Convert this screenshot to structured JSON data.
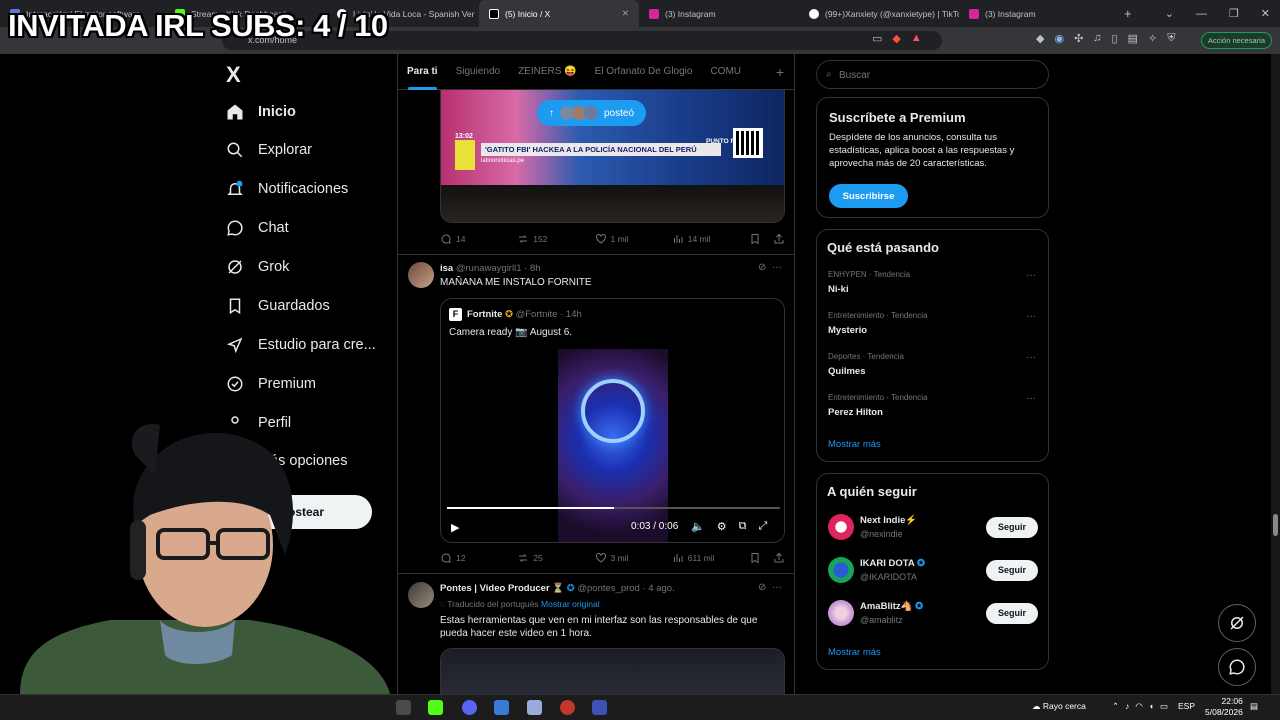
{
  "overlay": {
    "title": "INVITADA IRL SUBS: 4 / 10"
  },
  "browser": {
    "tabs": [
      {
        "label": "Interacción | El mejor software",
        "color": "#5a7bd6"
      },
      {
        "label": "Stream - Kick Dashboard",
        "color": "#53fc18"
      },
      {
        "label": "Livin' la Vida Loca - Spanish Ver",
        "color": "#ffffff"
      },
      {
        "label": "(5) Inicio / X",
        "color": "#ffffff"
      },
      {
        "label": "(3) Instagram",
        "color": "#d6249f"
      },
      {
        "label": "(99+)Xanxiety (@xanxietype) | TikTo",
        "color": "#ffffff"
      },
      {
        "label": "(3) Instagram",
        "color": "#d6249f"
      }
    ],
    "url": "x.com/home",
    "action_button": "Acción necesaria"
  },
  "nav": {
    "logo": "X",
    "items": [
      {
        "label": "Inicio",
        "icon": "home-icon"
      },
      {
        "label": "Explorar",
        "icon": "search-icon"
      },
      {
        "label": "Notificaciones",
        "icon": "bell-icon"
      },
      {
        "label": "Chat",
        "icon": "chat-icon"
      },
      {
        "label": "Grok",
        "icon": "grok-icon"
      },
      {
        "label": "Guardados",
        "icon": "bookmark-icon"
      },
      {
        "label": "Estudio para cre...",
        "icon": "rocket-icon"
      },
      {
        "label": "Premium",
        "icon": "verified-icon"
      },
      {
        "label": "Perfil",
        "icon": "person-icon"
      },
      {
        "label": "Más opciones",
        "icon": "more-icon"
      }
    ],
    "post_button": "Postear"
  },
  "feed": {
    "tabs": [
      "Para ti",
      "Siguiendo",
      "ZEINERS 😝",
      "El Orfanato De Glogio",
      "COMU"
    ],
    "tweet1": {
      "posted_pill": "posteó",
      "headline": "'GATITO FBI' HACKEA A LA POLICÍA NACIONAL DEL PERÚ",
      "source": "latinonoticias.pe",
      "badge_top": "PUNTO FINAL",
      "time": "13:02",
      "replies": "14",
      "reposts": "152",
      "likes": "1 mil",
      "views": "14 mil"
    },
    "tweet2": {
      "name": "isa",
      "handle": "@runawaygirll1",
      "time": "8h",
      "text": "MAÑANA ME INSTALO FORNITE",
      "quote": {
        "name": "Fortnite",
        "handle": "@Fortnite",
        "time": "14h",
        "text": "Camera ready 📷 August 6.",
        "video_time": "0:03 / 0:06",
        "progress": 0.5
      },
      "replies": "12",
      "reposts": "25",
      "likes": "3 mil",
      "views": "611 mil"
    },
    "tweet3": {
      "name": "Pontes | Video Producer ⏳",
      "handle": "@pontes_prod",
      "time": "4 ago.",
      "translated": "Traducido del portugués",
      "show_original": "Mostrar original",
      "text": "Estas herramientas que ven en mi interfaz son las responsables de que pueda hacer este video en 1 hora."
    }
  },
  "rail": {
    "search_placeholder": "Buscar",
    "premium": {
      "title": "Suscríbete a Premium",
      "body": "Despídete de los anuncios, consulta tus estadísticas, aplica boost a las respuestas y aprovecha más de 20 características.",
      "button": "Suscribirse"
    },
    "trends": {
      "title": "Qué está pasando",
      "items": [
        {
          "category": "ENHYPEN · Tendencia",
          "name": "Ni-ki"
        },
        {
          "category": "Entretenimiento · Tendencia",
          "name": "Mysterio"
        },
        {
          "category": "Deportes · Tendencia",
          "name": "Quilmes"
        },
        {
          "category": "Entretenimiento · Tendencia",
          "name": "Perez Hilton"
        }
      ],
      "more": "Mostrar más"
    },
    "who": {
      "title": "A quién seguir",
      "items": [
        {
          "name": "Next Indie⚡",
          "handle": "@nexindie",
          "button": "Seguir",
          "color": "#e0245e"
        },
        {
          "name": "IKARI DOTA",
          "handle": "@IKARIDOTA",
          "button": "Seguir",
          "color": "#17a35a"
        },
        {
          "name": "AmaBlitz🐴",
          "handle": "@amablitz",
          "button": "Seguir",
          "color": "#c79ad6"
        }
      ],
      "more": "Mostrar más"
    }
  },
  "taskbar": {
    "weather": "Rayo cerca",
    "lang": "ESP",
    "time": "22:06",
    "date": "5/08/2026"
  }
}
